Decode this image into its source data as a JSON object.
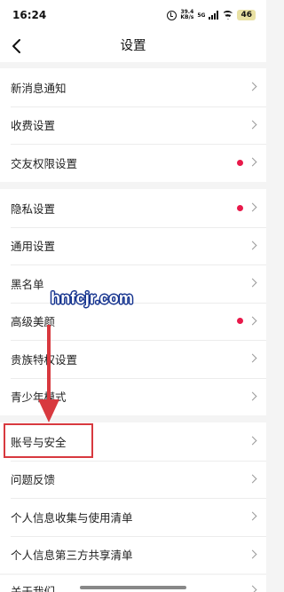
{
  "status_bar": {
    "time": "16:24",
    "net_speed_value": "39.4",
    "net_speed_unit": "KB/s",
    "network_type": "5G",
    "battery": "46"
  },
  "header": {
    "title": "设置"
  },
  "groups": [
    {
      "items": [
        {
          "label": "新消息通知",
          "has_dot": false
        },
        {
          "label": "收费设置",
          "has_dot": false
        },
        {
          "label": "交友权限设置",
          "has_dot": true
        }
      ]
    },
    {
      "items": [
        {
          "label": "隐私设置",
          "has_dot": true
        },
        {
          "label": "通用设置",
          "has_dot": false
        },
        {
          "label": "黑名单",
          "has_dot": false
        },
        {
          "label": "高级美颜",
          "has_dot": true
        },
        {
          "label": "贵族特权设置",
          "has_dot": false
        },
        {
          "label": "青少年模式",
          "has_dot": false
        }
      ]
    },
    {
      "items": [
        {
          "label": "账号与安全",
          "has_dot": false
        },
        {
          "label": "问题反馈",
          "has_dot": false
        },
        {
          "label": "个人信息收集与使用清单",
          "has_dot": false
        },
        {
          "label": "个人信息第三方共享清单",
          "has_dot": false
        },
        {
          "label": "关于我们",
          "has_dot": false
        }
      ]
    }
  ],
  "watermark": "hnfcjr.com",
  "colors": {
    "dot": "#e8194a",
    "annotation": "#d8393f",
    "watermark_outline": "#16348f",
    "background": "#f4f4f4"
  }
}
